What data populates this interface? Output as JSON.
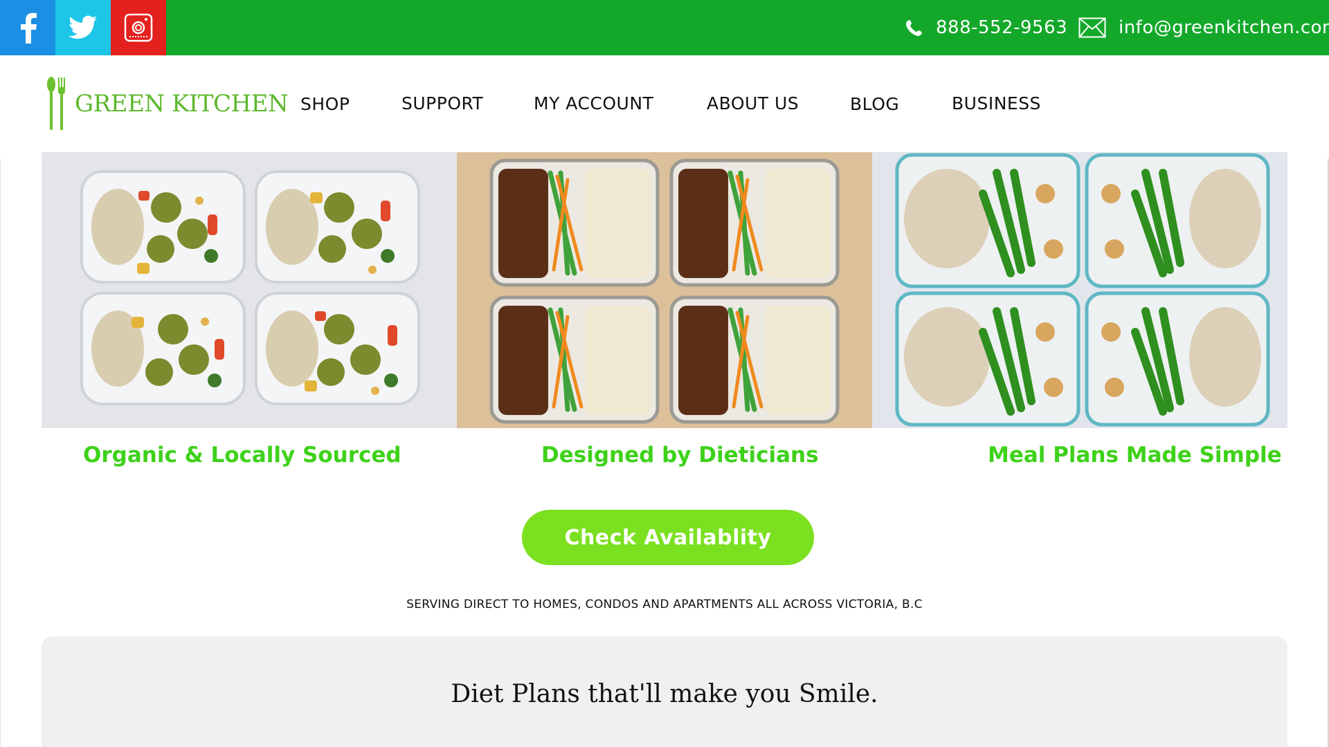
{
  "topbar": {
    "social": [
      "facebook-icon",
      "twitter-icon",
      "instagram-icon"
    ],
    "phone": "888-552-9563",
    "email": "info@greenkitchen.com",
    "colors": {
      "bar": "#14a82b",
      "facebook": "#1a8fe3",
      "twitter": "#1dc5e8",
      "instagram": "#e3211f"
    }
  },
  "nav": {
    "logo_text": "GREEN KITCHEN",
    "items": [
      "SHOP",
      "SUPPORT",
      "MY ACCOUNT",
      "ABOUT US",
      "BLOG",
      "BUSINESS"
    ]
  },
  "features": [
    "Organic & Locally Sourced",
    "Designed by Dieticians",
    "Meal Plans Made Simple"
  ],
  "cta_label": "Check Availablity",
  "serving_text": "SERVING DIRECT TO HOMES, CONDOS AND APARTMENTS ALL ACROSS VICTORIA, B.C",
  "plans_title": "Diet Plans that'll make you Smile.",
  "accent_colors": {
    "feature_green": "#3ed11a",
    "cta_green": "#7be01f",
    "logo_green": "#5cb82c"
  }
}
